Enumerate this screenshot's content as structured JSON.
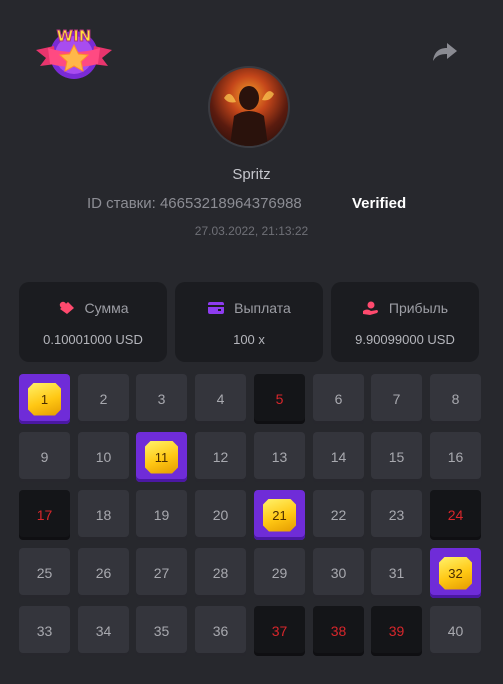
{
  "header": {
    "logo_text": "WIN",
    "share_icon": "share-icon"
  },
  "profile": {
    "name": "Spritz",
    "id_label": "ID ставки: 46653218964376988",
    "verified": "Verified",
    "date": "27.03.2022, 21:13:22"
  },
  "stats": [
    {
      "label": "Сумма",
      "value": "0.10001000 USD",
      "icon": "coins-icon",
      "color": "#ff4a6e"
    },
    {
      "label": "Выплата",
      "value": "100 x",
      "icon": "wallet-icon",
      "color": "#8e3cf0"
    },
    {
      "label": "Прибыль",
      "value": "9.90099000 USD",
      "icon": "profit-hand-icon",
      "color": "#ff4a6e"
    }
  ],
  "grid": {
    "cells": [
      {
        "n": "1",
        "state": "win"
      },
      {
        "n": "2",
        "state": "normal"
      },
      {
        "n": "3",
        "state": "normal"
      },
      {
        "n": "4",
        "state": "normal"
      },
      {
        "n": "5",
        "state": "lost"
      },
      {
        "n": "6",
        "state": "normal"
      },
      {
        "n": "7",
        "state": "normal"
      },
      {
        "n": "8",
        "state": "normal"
      },
      {
        "n": "9",
        "state": "normal"
      },
      {
        "n": "10",
        "state": "normal"
      },
      {
        "n": "11",
        "state": "win"
      },
      {
        "n": "12",
        "state": "normal"
      },
      {
        "n": "13",
        "state": "normal"
      },
      {
        "n": "14",
        "state": "normal"
      },
      {
        "n": "15",
        "state": "normal"
      },
      {
        "n": "16",
        "state": "normal"
      },
      {
        "n": "17",
        "state": "lost"
      },
      {
        "n": "18",
        "state": "normal"
      },
      {
        "n": "19",
        "state": "normal"
      },
      {
        "n": "20",
        "state": "normal"
      },
      {
        "n": "21",
        "state": "win"
      },
      {
        "n": "22",
        "state": "normal"
      },
      {
        "n": "23",
        "state": "normal"
      },
      {
        "n": "24",
        "state": "lost"
      },
      {
        "n": "25",
        "state": "normal"
      },
      {
        "n": "26",
        "state": "normal"
      },
      {
        "n": "27",
        "state": "normal"
      },
      {
        "n": "28",
        "state": "normal"
      },
      {
        "n": "29",
        "state": "normal"
      },
      {
        "n": "30",
        "state": "normal"
      },
      {
        "n": "31",
        "state": "normal"
      },
      {
        "n": "32",
        "state": "win"
      },
      {
        "n": "33",
        "state": "normal"
      },
      {
        "n": "34",
        "state": "normal"
      },
      {
        "n": "35",
        "state": "normal"
      },
      {
        "n": "36",
        "state": "normal"
      },
      {
        "n": "37",
        "state": "lost"
      },
      {
        "n": "38",
        "state": "lost"
      },
      {
        "n": "39",
        "state": "lost"
      },
      {
        "n": "40",
        "state": "normal"
      }
    ]
  }
}
